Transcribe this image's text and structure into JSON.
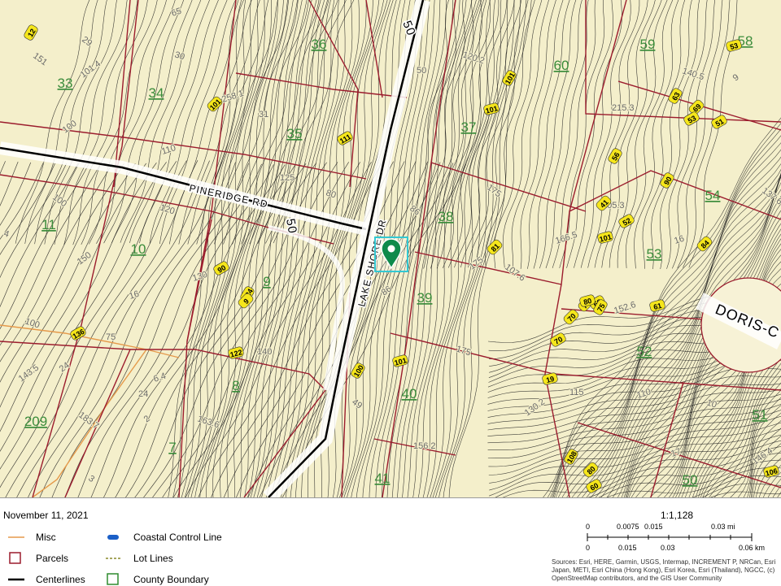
{
  "map": {
    "roads": [
      {
        "id": "pineridge",
        "name": "PINERIDGE RD"
      },
      {
        "id": "lakeshore",
        "name": "LAKE SHORE DR"
      },
      {
        "id": "doris",
        "name": "DORIS-C"
      }
    ],
    "road_numbers": [
      "50",
      "50"
    ],
    "parcels": [
      "33",
      "34",
      "35",
      "36",
      "37",
      "38",
      "39",
      "40",
      "41",
      "11",
      "10",
      "9",
      "8",
      "7",
      "209",
      "59",
      "58",
      "60",
      "54",
      "53",
      "52",
      "51",
      "50"
    ],
    "contour_labels": [
      "100",
      "110",
      "125",
      "120",
      "100",
      "150",
      "130",
      "140",
      "175",
      "175",
      "175",
      "152.6",
      "156.2",
      "163.6",
      "183.7",
      "143.5",
      "6.4",
      "75",
      "100",
      "151",
      "101.4",
      "258.1",
      "215.3",
      "140.5",
      "137.6",
      "146.4",
      "110",
      "115",
      "120.2",
      "107.6",
      "130.2",
      "166.5",
      "105.3",
      "80",
      "86",
      "86",
      "65",
      "50",
      "30",
      "29",
      "24",
      "16",
      "24",
      "4",
      "3",
      "2",
      "17",
      "31",
      "10",
      "49",
      "9",
      "16"
    ],
    "elevation_tags": [
      "12",
      "101",
      "111",
      "101",
      "101",
      "81",
      "90",
      "122",
      "124",
      "9",
      "136",
      "101",
      "100",
      "73",
      "68",
      "61",
      "63",
      "69",
      "51",
      "53",
      "56",
      "41",
      "52",
      "101",
      "90",
      "84",
      "53",
      "80",
      "75",
      "70",
      "70",
      "19",
      "108",
      "80",
      "60",
      "106"
    ],
    "colors": {
      "background": "#f4efcb",
      "contour": "#1e1e1e",
      "parcel_line": "#9b1c2d",
      "centerline": "#000000",
      "parcel_label": "#3b8c3b",
      "elevation_tag": "#f5e61b",
      "marker": "#0e8a4b",
      "selection": "#33c8d2",
      "misc_line": "#e59a4b"
    }
  },
  "footer": {
    "date": "November 11, 2021",
    "legend": [
      {
        "label": "Misc",
        "symbol": "line-orange"
      },
      {
        "label": "Parcels",
        "symbol": "square-red"
      },
      {
        "label": "Centerlines",
        "symbol": "line-black"
      },
      {
        "label": "Coastal Control Line",
        "symbol": "dash-blue"
      },
      {
        "label": "Lot Lines",
        "symbol": "dash-olive"
      },
      {
        "label": "County Boundary",
        "symbol": "square-green"
      }
    ],
    "scale_ratio": "1:1,128",
    "scale_top": [
      "0",
      "0.0075",
      "0.015",
      "0.03 mi"
    ],
    "scale_bottom": [
      "0",
      "0.015",
      "0.03",
      "0.06 km"
    ],
    "sources": "Sources: Esri, HERE, Garmin, USGS, Intermap, INCREMENT P, NRCan, Esri Japan, METI, Esri China (Hong Kong), Esri Korea, Esri (Thailand), NGCC, (c) OpenStreetMap contributors, and the GIS User Community"
  }
}
